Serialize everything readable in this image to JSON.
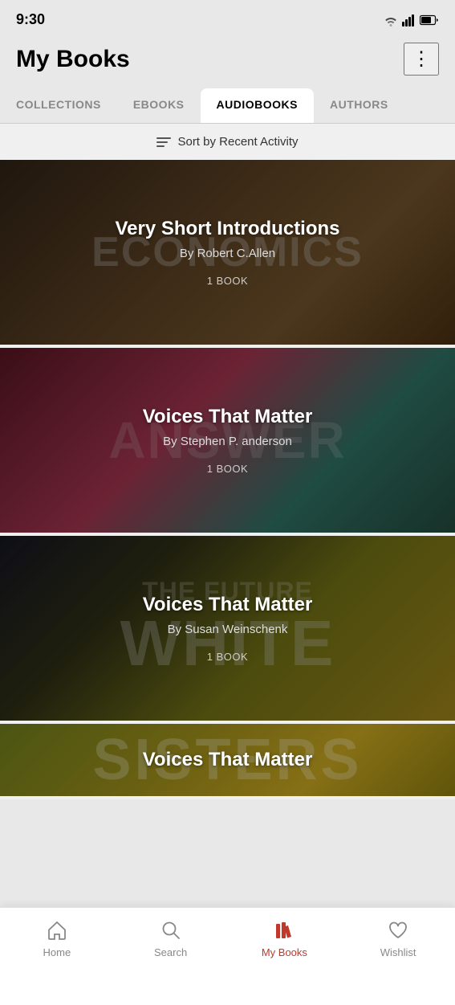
{
  "statusBar": {
    "time": "9:30"
  },
  "header": {
    "title": "My Books",
    "menuLabel": "⋮"
  },
  "tabs": [
    {
      "id": "collections",
      "label": "COLLECTIONS",
      "active": false
    },
    {
      "id": "ebooks",
      "label": "EBOOKS",
      "active": false
    },
    {
      "id": "audiobooks",
      "label": "AUDIOBOOKS",
      "active": true
    },
    {
      "id": "authors",
      "label": "AUTHORS",
      "active": false
    }
  ],
  "sortBar": {
    "label": "Sort by Recent Activity"
  },
  "books": [
    {
      "title": "Very Short Introductions",
      "author": "By Robert C.Allen",
      "count": "1 BOOK",
      "bgClass": "card-bg-1",
      "bgText": "ECONOMICS"
    },
    {
      "title": "Voices That Matter",
      "author": "By Stephen P. anderson",
      "count": "1 BOOK",
      "bgClass": "card-bg-2",
      "bgText": "ANSWER"
    },
    {
      "title": "Voices That Matter",
      "author": "By Susan Weinschenk",
      "count": "1 BOOK",
      "bgClass": "card-bg-3",
      "bgText": "THE FUTURE WHITE"
    },
    {
      "title": "Voices That Matter",
      "author": "",
      "count": "",
      "bgClass": "card-bg-4",
      "bgText": "SISTERS"
    }
  ],
  "bottomNav": [
    {
      "id": "home",
      "label": "Home",
      "active": false,
      "icon": "home-icon"
    },
    {
      "id": "search",
      "label": "Search",
      "active": false,
      "icon": "search-icon"
    },
    {
      "id": "mybooks",
      "label": "My Books",
      "active": true,
      "icon": "books-icon"
    },
    {
      "id": "wishlist",
      "label": "Wishlist",
      "active": false,
      "icon": "heart-icon"
    }
  ]
}
